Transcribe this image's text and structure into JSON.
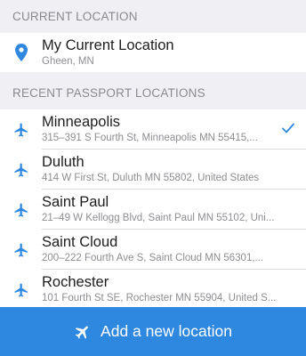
{
  "current_section": {
    "header": "CURRENT LOCATION",
    "item": {
      "title": "My Current Location",
      "subtitle": "Gheen, MN",
      "icon": "location-pin-icon"
    }
  },
  "recent_section": {
    "header": "RECENT PASSPORT LOCATIONS",
    "items": [
      {
        "title": "Minneapolis",
        "subtitle": "315–391 S Fourth St, Minneapolis MN 55415,...",
        "selected": true
      },
      {
        "title": "Duluth",
        "subtitle": "414 W First St, Duluth MN 55802, United States",
        "selected": false
      },
      {
        "title": "Saint Paul",
        "subtitle": "21–49 W Kellogg Blvd, Saint Paul MN 55102, Uni...",
        "selected": false
      },
      {
        "title": "Saint Cloud",
        "subtitle": "200–222 Fourth Ave S, Saint Cloud MN 56301,...",
        "selected": false
      },
      {
        "title": "Rochester",
        "subtitle": "101 Fourth St SE, Rochester MN 55904, United S...",
        "selected": false
      }
    ]
  },
  "add_button": {
    "label": "Add a new location",
    "icon": "airplane-icon"
  },
  "colors": {
    "accent": "#2f88df",
    "background": "#efeff4"
  }
}
